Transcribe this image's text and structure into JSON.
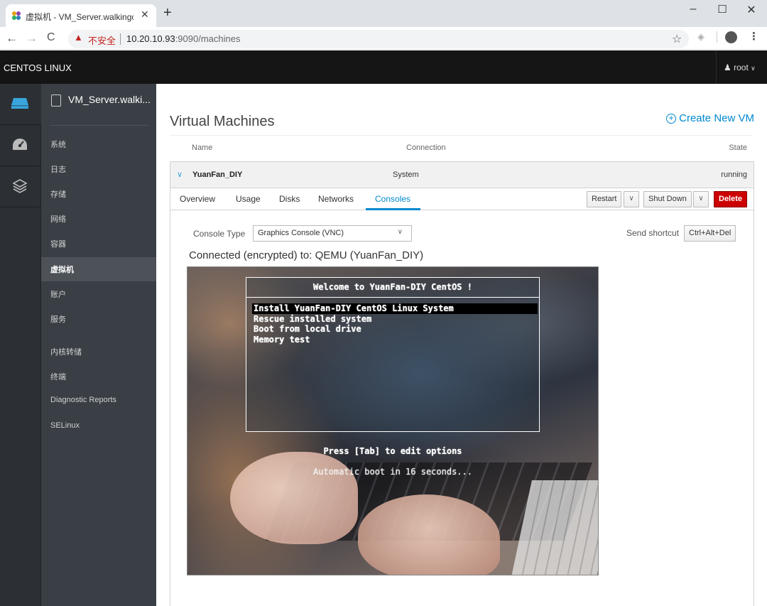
{
  "browser": {
    "tab_title": "虚拟机 - VM_Server.walkingcloud",
    "close_tab": "✕",
    "new_tab": "+",
    "win_minimize": "–",
    "win_maximize": "☐",
    "win_close": "✕",
    "insecure_label": "不安全",
    "url_host": "10.20.10.93",
    "url_rest": ":9090/machines"
  },
  "topbar": {
    "brand": "CENTOS LINUX",
    "user": "root"
  },
  "sidebar": {
    "host": "VM_Server.walki...",
    "items": [
      {
        "label": "系统"
      },
      {
        "label": "日志"
      },
      {
        "label": "存储"
      },
      {
        "label": "网络"
      },
      {
        "label": "容器"
      },
      {
        "label": "虚拟机",
        "active": true
      },
      {
        "label": "账户"
      },
      {
        "label": "服务"
      },
      {
        "label": "内核转储"
      },
      {
        "label": "终端"
      },
      {
        "label": "Diagnostic Reports"
      },
      {
        "label": "SELinux"
      }
    ]
  },
  "main": {
    "title": "Virtual Machines",
    "create_vm": "Create New VM",
    "columns": {
      "name": "Name",
      "connection": "Connection",
      "state": "State"
    },
    "vm": {
      "name": "YuanFan_DIY",
      "connection": "System",
      "state": "running"
    },
    "tabs": [
      "Overview",
      "Usage",
      "Disks",
      "Networks",
      "Consoles"
    ],
    "active_tab": "Consoles",
    "buttons": {
      "restart": "Restart",
      "shutdown": "Shut Down",
      "delete": "Delete"
    },
    "console": {
      "type_label": "Console Type",
      "type_value": "Graphics Console (VNC)",
      "send_shortcut_label": "Send shortcut",
      "shortcut_button": "Ctrl+Alt+Del",
      "connected_text": "Connected (encrypted) to: QEMU (YuanFan_DIY)"
    },
    "boot": {
      "title": "Welcome to YuanFan-DIY CentOS !",
      "options": [
        "Install YuanFan-DIY CentOS Linux System",
        "Rescue installed system",
        "Boot from local drive",
        "Memory test"
      ],
      "hint": "Press [Tab] to edit options",
      "autoboot": "Automatic boot in 16 seconds..."
    }
  },
  "colors": {
    "accent": "#0088ce",
    "delete": "#cc0000",
    "topbar": "#151515",
    "sidebar": "#393f44"
  }
}
